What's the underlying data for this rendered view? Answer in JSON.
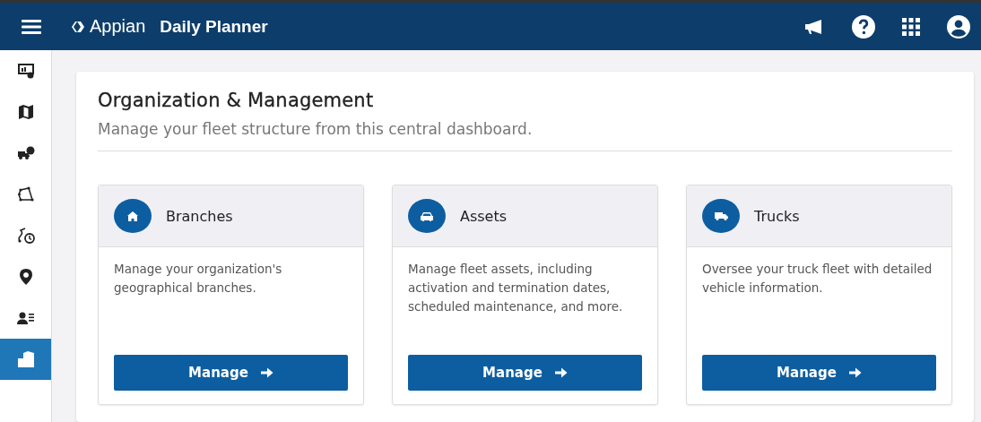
{
  "header": {
    "brand": "Appian",
    "app_title": "Daily Planner"
  },
  "sidebar": {
    "items": [
      {
        "selected": false
      },
      {
        "selected": false
      },
      {
        "selected": false
      },
      {
        "selected": false
      },
      {
        "selected": false
      },
      {
        "selected": false
      },
      {
        "selected": false
      },
      {
        "selected": true
      }
    ]
  },
  "page": {
    "title": "Organization & Management",
    "subtitle": "Manage your fleet structure from this central dashboard."
  },
  "cards": [
    {
      "kind": "house",
      "title": "Branches",
      "description": "Manage your organization's geographical branches.",
      "button": "Manage"
    },
    {
      "kind": "car",
      "title": "Assets",
      "description": "Manage fleet assets, including activation and termination dates, scheduled maintenance, and more.",
      "button": "Manage"
    },
    {
      "kind": "truck",
      "title": "Trucks",
      "description": "Oversee your truck fleet with detailed vehicle information.",
      "button": "Manage"
    }
  ]
}
